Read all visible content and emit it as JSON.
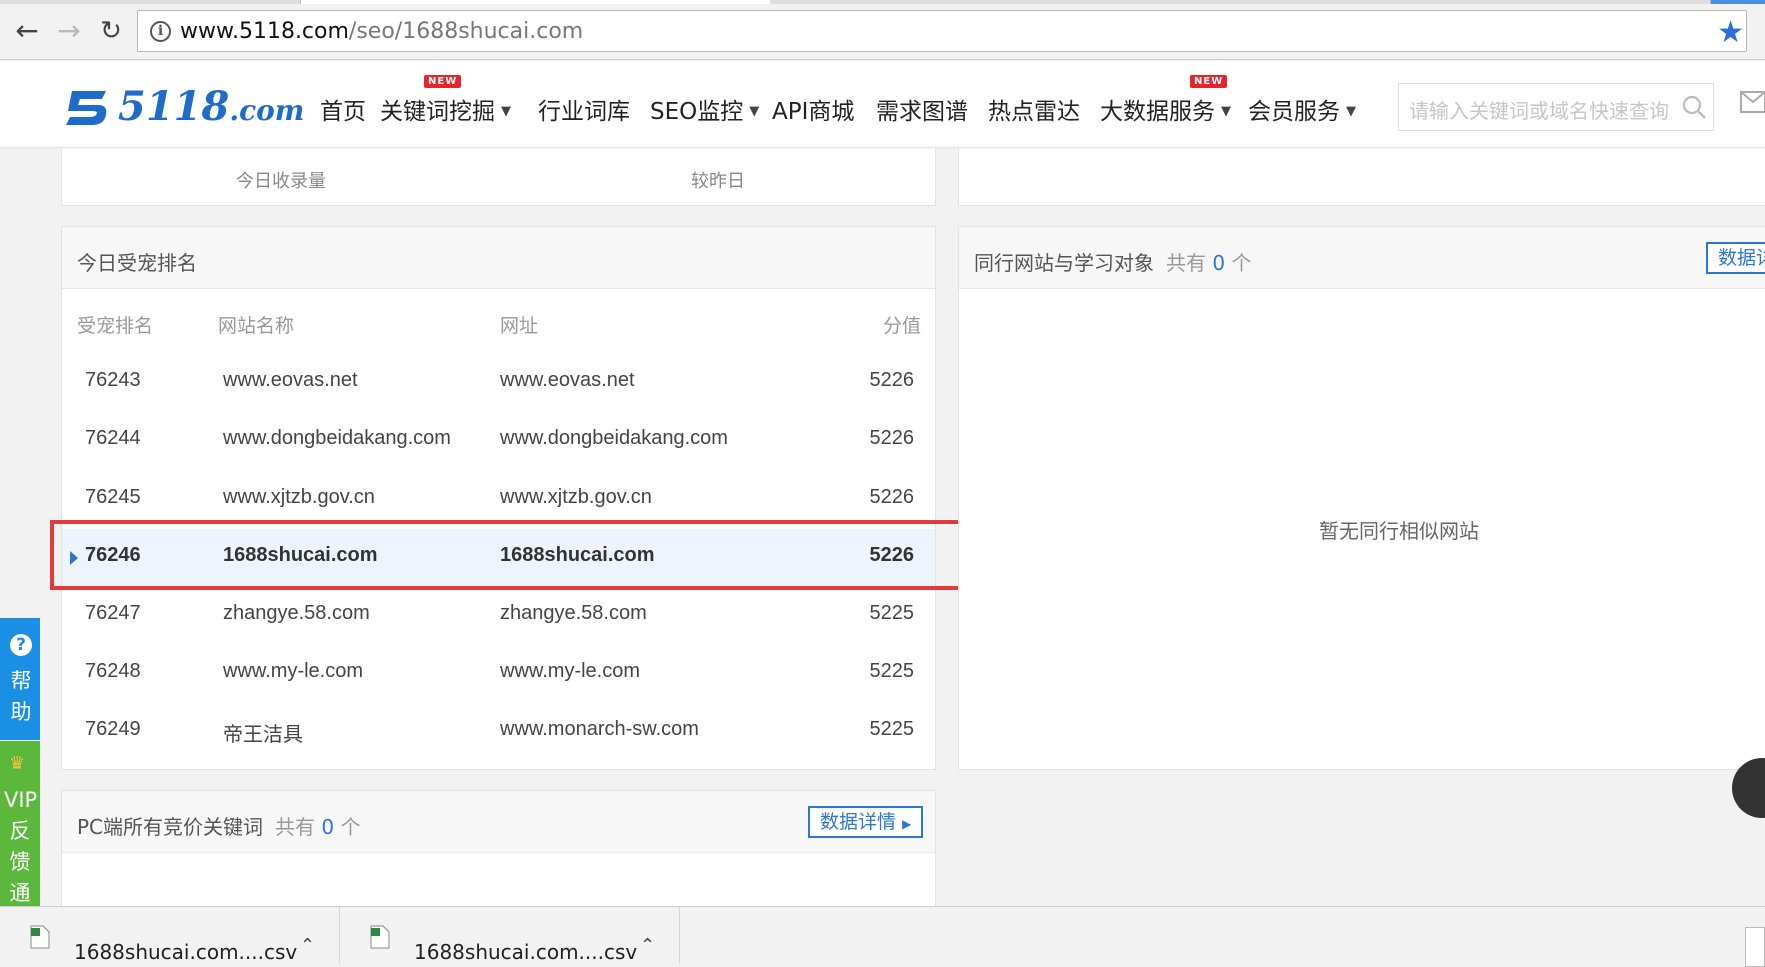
{
  "browser": {
    "url_host": "www.5118.com",
    "url_path": "/seo/1688shucai.com"
  },
  "header": {
    "logo_number": "5118",
    "logo_domain": ".com",
    "nav": [
      {
        "label": "首页"
      },
      {
        "label": "关键词挖掘",
        "badge": "NEW",
        "dropdown": true
      },
      {
        "label": "行业词库"
      },
      {
        "label": "SEO监控",
        "dropdown": true
      },
      {
        "label": "API商城"
      },
      {
        "label": "需求图谱"
      },
      {
        "label": "热点雷达"
      },
      {
        "label": "大数据服务",
        "badge": "NEW",
        "dropdown": true
      },
      {
        "label": "会员服务",
        "dropdown": true
      }
    ],
    "search_placeholder": "请输入关键词或域名快速查询"
  },
  "stats_panel": {
    "labels": [
      "今日收录量",
      "较昨日"
    ]
  },
  "rank_panel": {
    "title": "今日受宠排名",
    "columns": [
      "受宠排名",
      "网站名称",
      "网址",
      "分值"
    ],
    "rows": [
      {
        "rank": "76243",
        "name": "www.eovas.net",
        "url": "www.eovas.net",
        "score": "5226"
      },
      {
        "rank": "76244",
        "name": "www.dongbeidakang.com",
        "url": "www.dongbeidakang.com",
        "score": "5226"
      },
      {
        "rank": "76245",
        "name": "www.xjtzb.gov.cn",
        "url": "www.xjtzb.gov.cn",
        "score": "5226"
      },
      {
        "rank": "76246",
        "name": "1688shucai.com",
        "url": "1688shucai.com",
        "score": "5226",
        "current": true
      },
      {
        "rank": "76247",
        "name": "zhangye.58.com",
        "url": "zhangye.58.com",
        "score": "5225"
      },
      {
        "rank": "76248",
        "name": "www.my-le.com",
        "url": "www.my-le.com",
        "score": "5225"
      },
      {
        "rank": "76249",
        "name": "帝王洁具",
        "url": "www.monarch-sw.com",
        "score": "5225"
      }
    ]
  },
  "peer_panel": {
    "title": "同行网站与学习对象",
    "count_prefix": "共有",
    "count": "0",
    "count_suffix": "个",
    "detail_button": "数据详",
    "empty_text": "暂无同行相似网站"
  },
  "ppc_panel": {
    "title": "PC端所有竞价关键词",
    "count_prefix": "共有",
    "count": "0",
    "count_suffix": "个",
    "detail_button": "数据详情"
  },
  "float_bar": {
    "help_label": "帮助",
    "vip_label_1": "VIP",
    "vip_label_2": "反馈通"
  },
  "downloads": [
    {
      "name": "1688shucai.com....csv"
    },
    {
      "name": "1688shucai.com....csv"
    }
  ],
  "colors": {
    "brand": "#1e6bc9",
    "link": "#2a78d2",
    "new_badge": "#e8242a",
    "highlight": "#e23b3f",
    "help_bg": "#1a8fe3",
    "vip_bg": "#5cb83c"
  }
}
